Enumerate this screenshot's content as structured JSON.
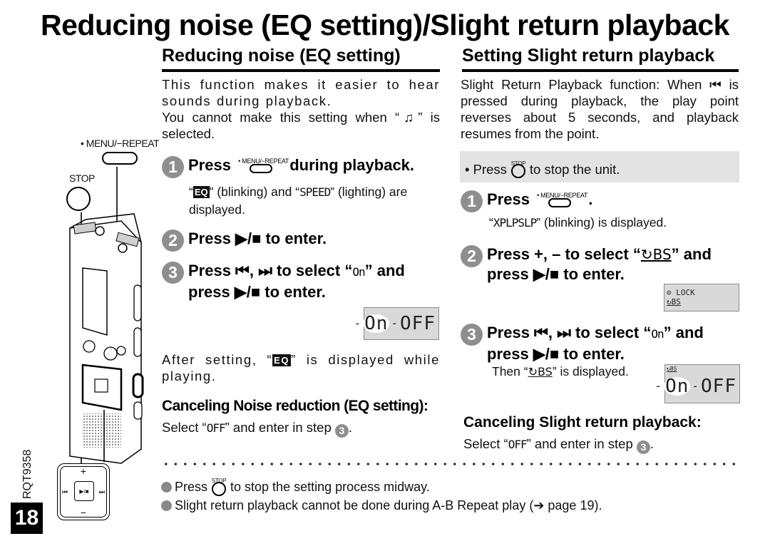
{
  "page": {
    "title": "Reducing noise (EQ setting)/Slight return playback",
    "number": "18",
    "doc_code": "RQT9358"
  },
  "illustration": {
    "menu_label": "• MENU/−REPEAT",
    "stop_label": "STOP",
    "pad": {
      "plus": "+",
      "minus": "−",
      "prev": "⏮",
      "next": "⏭",
      "center": "▶/■"
    }
  },
  "left": {
    "heading": "Reducing noise (EQ setting)",
    "intro_1": "This function makes it easier to hear sounds during playback.",
    "intro_2a": "You cannot make this setting when “",
    "intro_2_icon": "♫",
    "intro_2b": "” is selected.",
    "step1": {
      "num": "1",
      "pre": "Press",
      "button_label": "• MENU/−REPEAT",
      "post": "during playback.",
      "detail_a": "“",
      "detail_badge": "EQ",
      "detail_b": "” (blinking) and “",
      "detail_lcd": "SPEED",
      "detail_c": "” (lighting) are displayed."
    },
    "step2": {
      "num": "2",
      "text": "Press ▶/■ to enter."
    },
    "step3": {
      "num": "3",
      "text_a": "Press ⏮, ⏭ to select “",
      "lcd": "On",
      "text_b": "” and press ▶/■ to enter."
    },
    "lcd_display": {
      "selected": "On",
      "other": "OFF"
    },
    "after_a": "After setting, “",
    "after_badge": "EQ",
    "after_b": "” is displayed while playing.",
    "cancel_heading": "Canceling Noise reduction (EQ setting):",
    "cancel_a": "Select “",
    "cancel_lcd": "OFF",
    "cancel_b": "” and enter in step",
    "cancel_step": "3",
    "cancel_end": "."
  },
  "right": {
    "heading": "Setting Slight return playback",
    "intro": "Slight Return Playback function: When ⏮ is pressed during playback, the play point reverses about 5 seconds, and playback resumes from the point.",
    "stop_note_a": "• Press",
    "stop_label": "STOP",
    "stop_note_b": "to stop the unit.",
    "step1": {
      "num": "1",
      "pre": "Press",
      "button_label": "• MENU/−REPEAT",
      "post": ".",
      "detail_lcd": "XPLPSLP",
      "detail_rest": "” (blinking) is displayed."
    },
    "step2": {
      "num": "2",
      "text_a": "Press +, – to select “",
      "icon": "↻BS",
      "text_b": "” and press ▶/■ to enter."
    },
    "lcd_small": {
      "line1": "LOCK",
      "line2": "↻BS"
    },
    "step3": {
      "num": "3",
      "text_a": "Press ⏮, ⏭ to select “",
      "lcd": "On",
      "text_b": "” and press ▶/■ to enter.",
      "then_a": "Then “",
      "then_icon": "↻BS",
      "then_b": "” is displayed."
    },
    "lcd_display": {
      "corner": "↻BS",
      "selected": "On",
      "other": "OFF"
    },
    "cancel_heading": "Canceling Slight return playback:",
    "cancel_a": "Select “",
    "cancel_lcd": "OFF",
    "cancel_b": "” and enter in step",
    "cancel_step": "3",
    "cancel_end": "."
  },
  "notes": {
    "note1_a": "Press",
    "note1_stop": "STOP",
    "note1_b": "to stop the setting process midway.",
    "note2": "Slight return playback cannot be done during A-B Repeat play (➔ page 19)."
  }
}
